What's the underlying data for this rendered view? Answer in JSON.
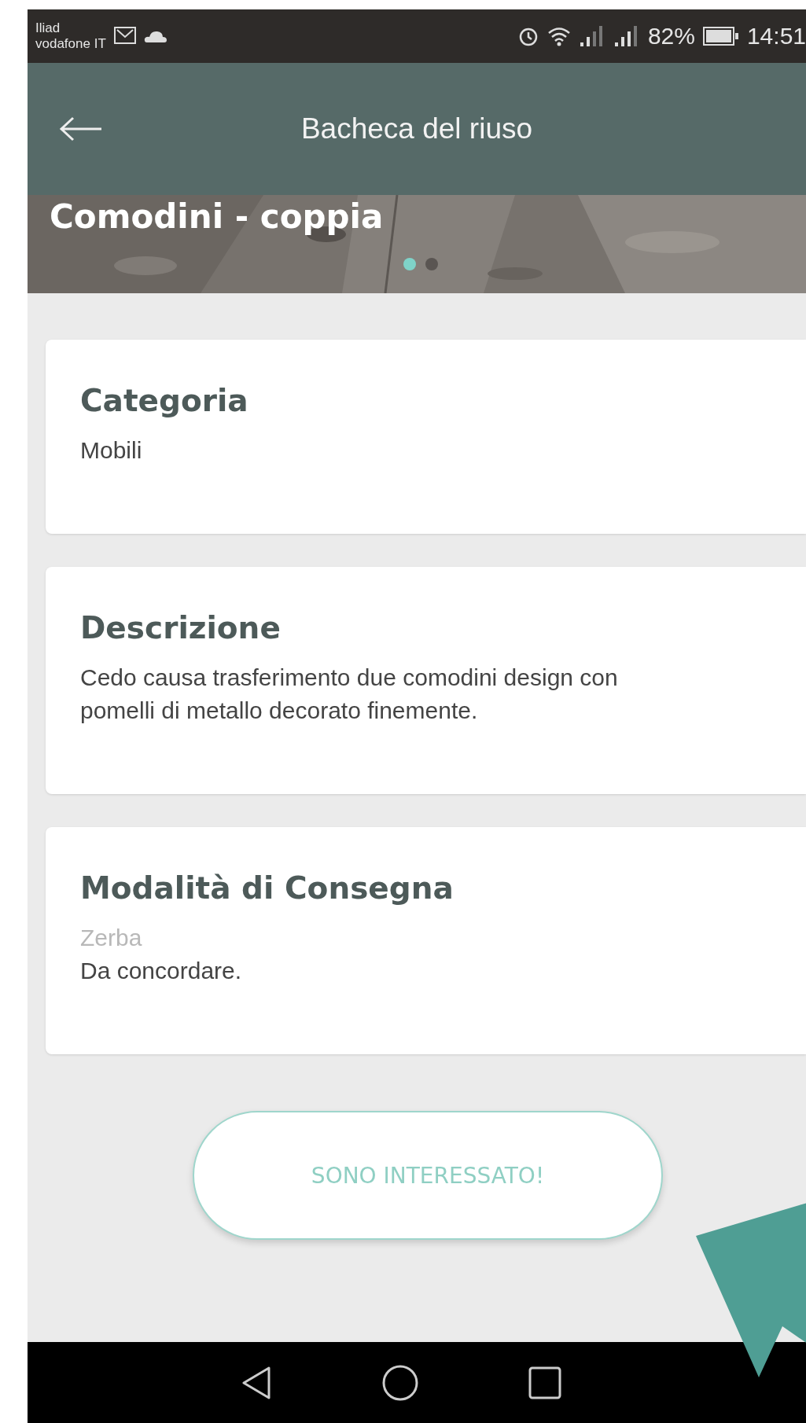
{
  "status_bar": {
    "carrier_1": "Iliad",
    "carrier_2": "vodafone IT",
    "battery_percent": "82%",
    "time": "14:51"
  },
  "app_bar": {
    "title": "Bacheca del riuso"
  },
  "hero": {
    "kind": "picture",
    "title": "Comodini - coppia",
    "dots": [
      {
        "selected": true
      },
      {
        "selected": false
      }
    ]
  },
  "cards": [
    {
      "title": "Categoria",
      "lines": [
        {
          "kind": "value",
          "text": "Mobili"
        }
      ]
    },
    {
      "title": "Descrizione",
      "lines": [
        {
          "kind": "value",
          "text": "Cedo causa trasferimento due comodini design con pomelli di metallo decorato finemente."
        }
      ]
    },
    {
      "title": "Modalità di Consegna",
      "lines": [
        {
          "kind": "hint",
          "text": "Zerba"
        },
        {
          "kind": "value",
          "text": "Da concordare."
        }
      ]
    }
  ],
  "action_button": {
    "label": "SONO INTERESSATO!"
  }
}
